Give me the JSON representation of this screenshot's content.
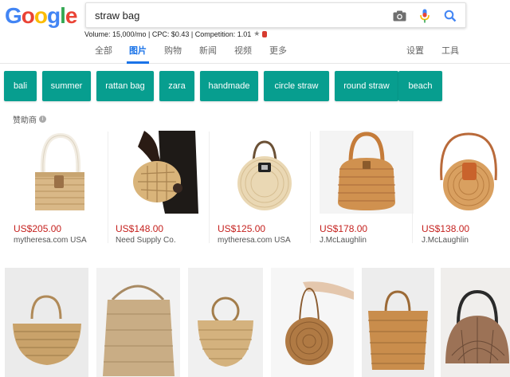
{
  "logo": {
    "letters": [
      "G",
      "o",
      "o",
      "g",
      "l",
      "e"
    ],
    "colors": [
      "#4285F4",
      "#EA4335",
      "#FBBC05",
      "#4285F4",
      "#34A853",
      "#EA4335"
    ]
  },
  "search": {
    "value": "straw bag",
    "camera_icon": "camera-icon",
    "mic_icon": "microphone-icon",
    "search_icon": "search-icon"
  },
  "keyword_bar": {
    "text": "Volume: 15,000/mo | CPC: $0.43 | Competition: 1.01"
  },
  "tabs": [
    {
      "label": "全部"
    },
    {
      "label": "图片"
    },
    {
      "label": "购物"
    },
    {
      "label": "新闻"
    },
    {
      "label": "视频"
    },
    {
      "label": "更多"
    },
    {
      "label": "设置"
    },
    {
      "label": "工具"
    }
  ],
  "chips": [
    {
      "label": "bali"
    },
    {
      "label": "summer"
    },
    {
      "label": "rattan bag"
    },
    {
      "label": "zara"
    },
    {
      "label": "handmade"
    },
    {
      "label": "circle straw"
    },
    {
      "label": "round straw"
    },
    {
      "label": "beach"
    }
  ],
  "sponsored": {
    "label": "赞助商",
    "products": [
      {
        "price": "US$205.00",
        "store": "mytheresa.com USA"
      },
      {
        "price": "US$148.00",
        "store": "Need Supply Co."
      },
      {
        "price": "US$125.00",
        "store": "mytheresa.com USA"
      },
      {
        "price": "US$178.00",
        "store": "J.McLaughlin"
      },
      {
        "price": "US$138.00",
        "store": "J.McLaughlin"
      }
    ]
  },
  "colors": {
    "accent": "#1a73e8",
    "chip": "#079e8f",
    "price": "#c5221f"
  }
}
